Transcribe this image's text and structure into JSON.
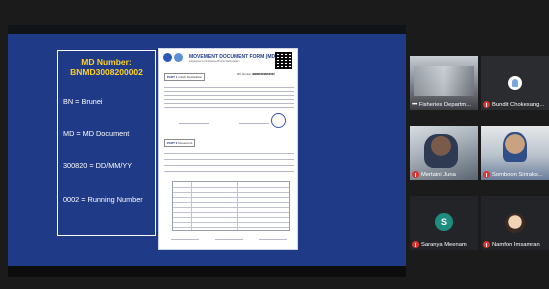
{
  "slide": {
    "info_title_line1": "MD Number:",
    "info_title_line2": "BNMD3008200002",
    "lines": [
      "BN = Brunei",
      "MD = MD Document",
      "300820 = DD/MM/YY",
      "0002 = Running Number"
    ]
  },
  "document": {
    "title": "MOVEMENT DOCUMENT FORM (MD)",
    "subtitle": "Department of Fisheries Brunei Darussalam",
    "part1": "PART 1",
    "part1_label": "Catch Declaration",
    "part2": "PART 2",
    "part2_label": "Movement",
    "md_no_label": "MD Number",
    "md_no": "BNMD3008200002"
  },
  "participants": [
    {
      "name": "Fisheries Departm...",
      "has_menu": true,
      "muted": false,
      "kind": "photo"
    },
    {
      "name": "Bundit Chokesang...",
      "has_menu": false,
      "muted": true,
      "kind": "photo"
    },
    {
      "name": "Mertaini Juna",
      "has_menu": false,
      "muted": true,
      "kind": "photo"
    },
    {
      "name": "Somboon Siriraks...",
      "has_menu": false,
      "muted": true,
      "kind": "photo"
    },
    {
      "name": "Saranya Meenam",
      "has_menu": false,
      "muted": true,
      "kind": "initial",
      "initial": "S"
    },
    {
      "name": "Namfon Imsamran",
      "has_menu": false,
      "muted": true,
      "kind": "photo"
    }
  ],
  "colors": {
    "slide_bg": "#1f3a86",
    "title_yellow": "#ffd21f",
    "mute_red": "#e0322e",
    "initial_avatar": "#1e8c7e"
  }
}
